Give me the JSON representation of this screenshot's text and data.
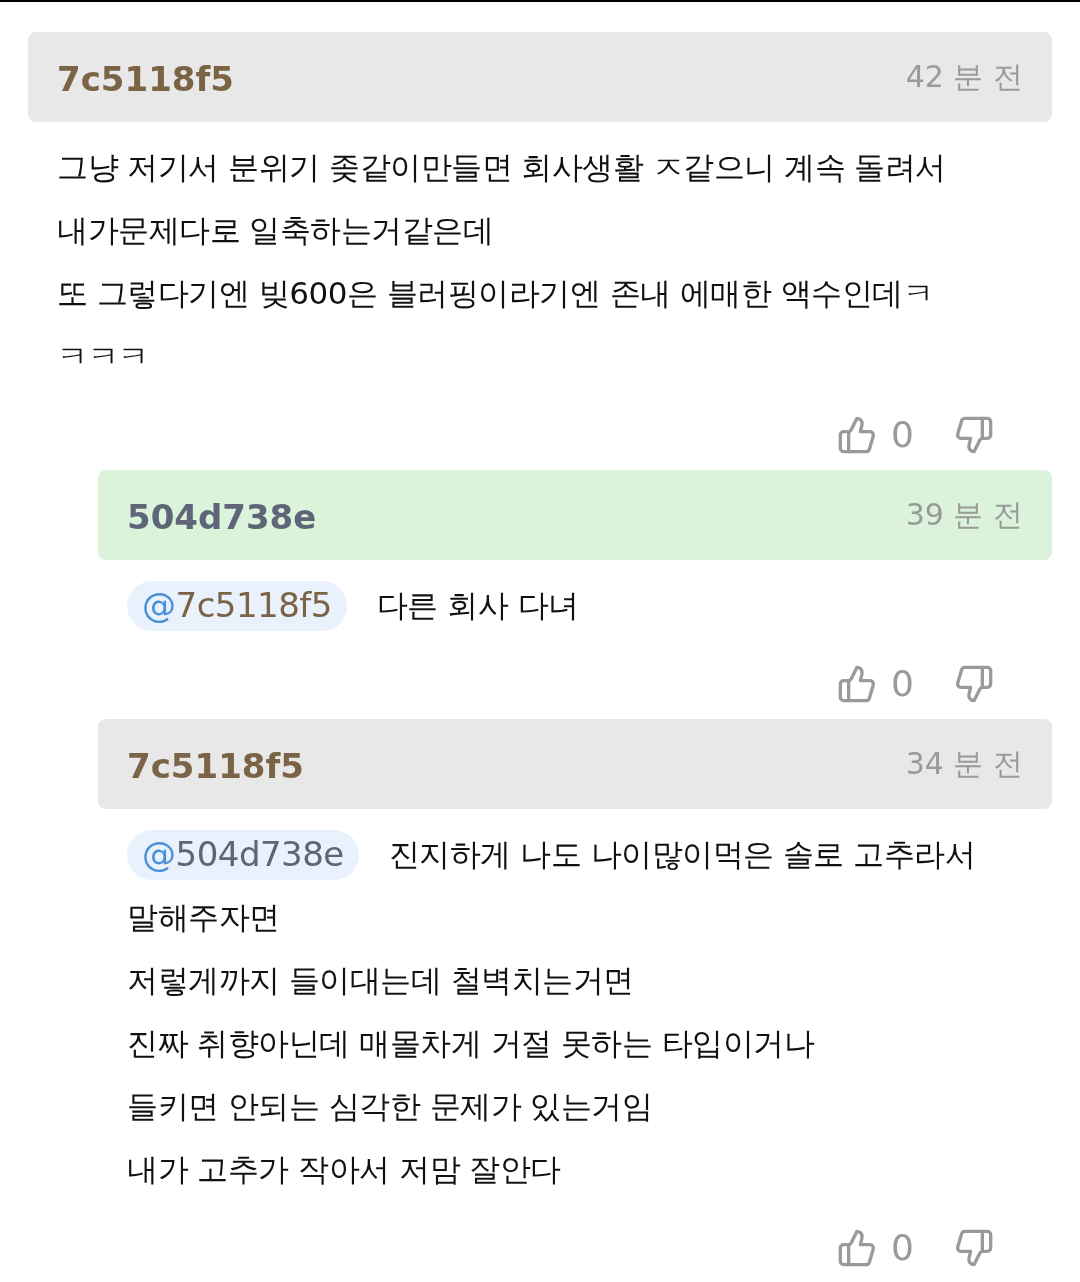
{
  "comments": [
    {
      "author": "7c5118f5",
      "color": "#7b6446",
      "highlighted": false,
      "reply": false,
      "time": "42 분 전",
      "lines": [
        "그냥 저기서 분위기 좆같이만들면 회사생활 ㅈ같으니 계속 돌려서",
        "내가문제다로 일축하는거같은데",
        "또 그렇다기엔 빚600은 블러핑이라기엔 존내 에매한 액수인데ㅋ",
        "ㅋㅋㅋ"
      ],
      "likes": "0"
    },
    {
      "author": "504d738e",
      "color": "#5f6577",
      "highlighted": true,
      "reply": true,
      "time": "39 분 전",
      "mention": {
        "at": "@",
        "handle": "7c5118f5",
        "color": "#7b6446"
      },
      "lines": [
        "다른 회사 다녀"
      ],
      "likes": "0"
    },
    {
      "author": "7c5118f5",
      "color": "#7b6446",
      "highlighted": false,
      "reply": true,
      "time": "34 분 전",
      "mention": {
        "at": "@",
        "handle": "504d738e",
        "color": "#5f6577"
      },
      "lines": [
        "진지하게 나도 나이많이먹은 솔로 고추라서",
        "말해주자면",
        "저렇게까지 들이대는데 철벽치는거면",
        "진짜 취향아닌데 매몰차게 거절 못하는 타입이거나",
        "들키면 안되는 심각한 문제가 있는거임",
        "내가 고추가 작아서 저맘 잘안다"
      ],
      "likes": "0"
    }
  ]
}
